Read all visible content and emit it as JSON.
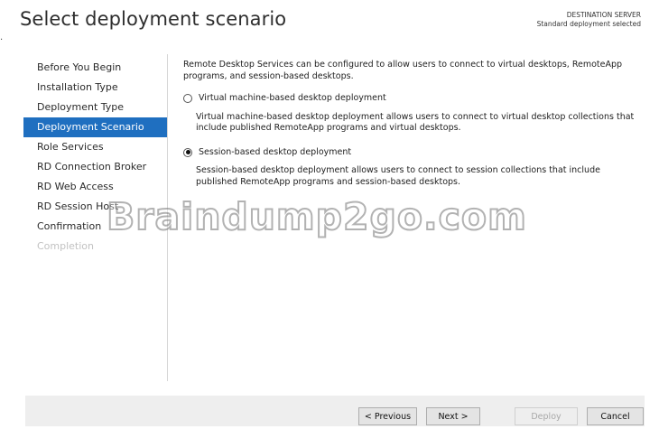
{
  "page": {
    "title": "Select deployment scenario",
    "corner_mark": "."
  },
  "server": {
    "label": "DESTINATION SERVER",
    "value": "Standard deployment selected"
  },
  "nav": {
    "items": [
      {
        "label": "Before You Begin",
        "state": "normal"
      },
      {
        "label": "Installation Type",
        "state": "normal"
      },
      {
        "label": "Deployment Type",
        "state": "normal"
      },
      {
        "label": "Deployment Scenario",
        "state": "active"
      },
      {
        "label": "Role Services",
        "state": "normal"
      },
      {
        "label": "RD Connection Broker",
        "state": "normal"
      },
      {
        "label": "RD Web Access",
        "state": "normal"
      },
      {
        "label": "RD Session Host",
        "state": "normal"
      },
      {
        "label": "Confirmation",
        "state": "normal"
      },
      {
        "label": "Completion",
        "state": "disabled"
      }
    ]
  },
  "content": {
    "intro": "Remote Desktop Services can be configured to allow users to connect to virtual desktops, RemoteApp programs, and session-based desktops.",
    "options": [
      {
        "label": "Virtual machine-based desktop deployment",
        "description": "Virtual machine-based desktop deployment allows users to connect to virtual desktop collections that include published RemoteApp programs and virtual desktops.",
        "selected": false
      },
      {
        "label": "Session-based desktop deployment",
        "description": "Session-based desktop deployment allows users to connect to session collections that include published RemoteApp programs and session-based desktops.",
        "selected": true
      }
    ]
  },
  "watermark": {
    "text": "Braindump2go.com"
  },
  "buttons": {
    "previous": "< Previous",
    "next": "Next >",
    "deploy": "Deploy",
    "cancel": "Cancel"
  },
  "colors": {
    "accent": "#1f6fc0",
    "disabled_text": "#c2c2c2",
    "footer_bg": "#eeeeee"
  }
}
